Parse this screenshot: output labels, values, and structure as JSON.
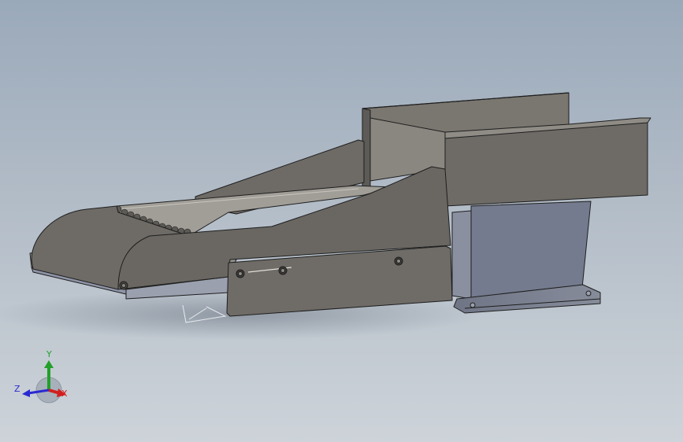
{
  "viewport": {
    "background_top": "#9aa9ba",
    "background_bottom": "#cdd3d9"
  },
  "model": {
    "part_color": "#6e6b66",
    "edge_color": "#1e1e1e",
    "base_color": "#737a8a"
  },
  "triad": {
    "x_label": "X",
    "y_label": "Y",
    "z_label": "Z",
    "x_color": "#d21e1e",
    "y_color": "#22a02a",
    "z_color": "#2a2ad2"
  }
}
